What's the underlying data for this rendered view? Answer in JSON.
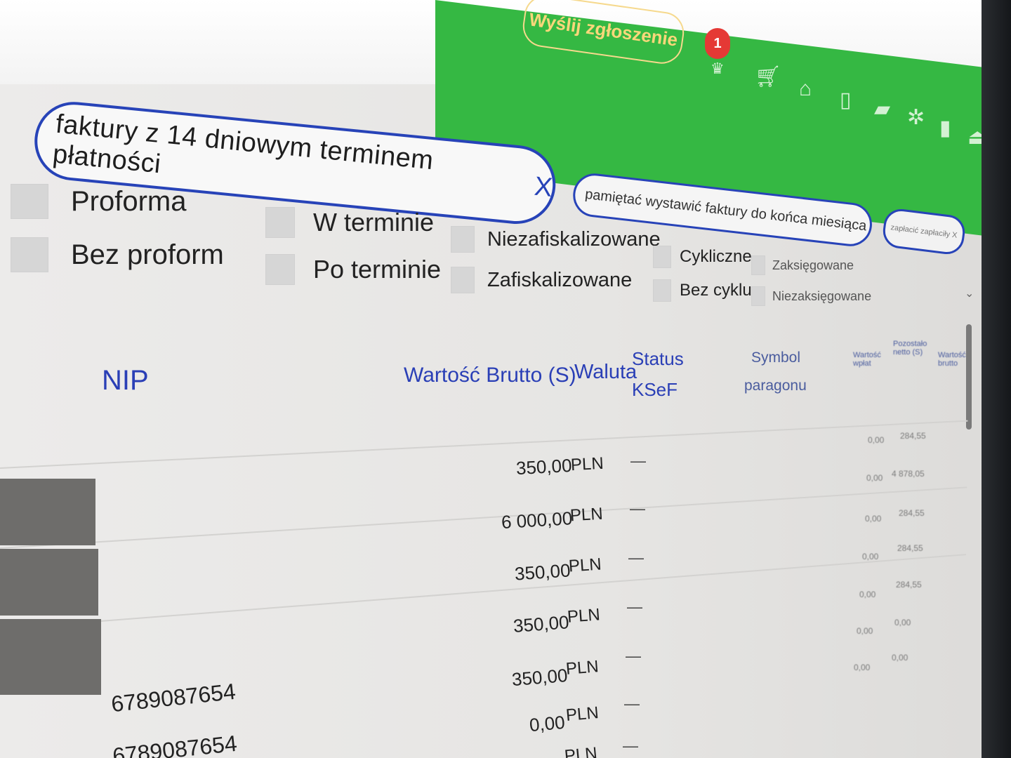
{
  "header": {
    "send_button": "Wyślij zgłoszenie",
    "notification_count": "1",
    "icons": [
      "trophy-icon",
      "cart-icon",
      "home-icon",
      "phone-icon",
      "chat-icon",
      "gear-icon",
      "bell-icon",
      "user-icon"
    ]
  },
  "filter_chips": {
    "main": "faktury z 14 dniowym terminem płatności",
    "main_close": "X",
    "second": "pamiętać wystawić faktury do końca miesiąca X",
    "third": "zapłacić zapłaciły X"
  },
  "filters": {
    "proforma": "Proforma",
    "no_proforma": "Bez proform",
    "on_time": "W terminie",
    "overdue": "Po terminie",
    "not_fiscalized": "Niezafiskalizowane",
    "fiscalized": "Zafiskalizowane",
    "cyclic": "Cykliczne",
    "no_cycle": "Bez cyklu",
    "booked": "Zaksięgowane",
    "not_booked": "Niezaksięgowane"
  },
  "table": {
    "columns": {
      "nip": "NIP",
      "gross": "Wartość Brutto (S)",
      "currency": "Waluta",
      "status": "Status",
      "ksef": "KSeF",
      "symbol": "Symbol",
      "receipt": "paragonu",
      "paid_value": "Wartość wpłat",
      "remaining": "Pozostało netto (S)",
      "vat_value": "Wartość brutto"
    },
    "rows": [
      {
        "nip": "",
        "gross": "350,00",
        "currency": "PLN",
        "status": "—",
        "extra1": "0,00",
        "extra2": "284,55"
      },
      {
        "nip": "",
        "gross": "6 000,00",
        "currency": "PLN",
        "status": "—",
        "extra1": "0,00",
        "extra2": "4 878,05"
      },
      {
        "nip": "",
        "gross": "350,00",
        "currency": "PLN",
        "status": "—",
        "extra1": "0,00",
        "extra2": "284,55"
      },
      {
        "nip": "",
        "gross": "350,00",
        "currency": "PLN",
        "status": "—",
        "extra1": "0,00",
        "extra2": "284,55"
      },
      {
        "nip": "",
        "gross": "350,00",
        "currency": "PLN",
        "status": "—",
        "extra1": "0,00",
        "extra2": "284,55"
      },
      {
        "nip": "6789087654",
        "gross": "0,00",
        "currency": "PLN",
        "status": "—",
        "extra1": "0,00",
        "extra2": "0,00"
      },
      {
        "nip": "6789087654",
        "gross": "",
        "currency": "PLN",
        "status": "—",
        "extra1": "0,00",
        "extra2": "0,00"
      }
    ]
  }
}
